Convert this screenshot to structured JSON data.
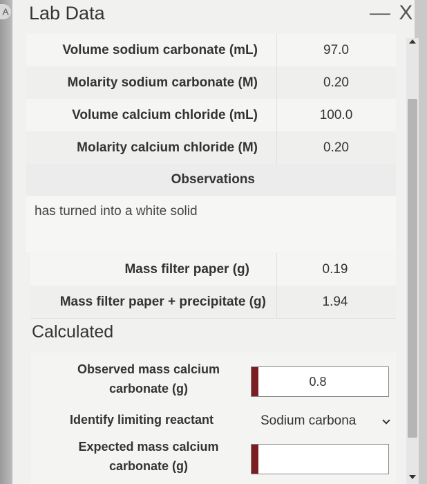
{
  "window": {
    "title": "Lab Data",
    "close_label": "— X",
    "corner_glyph": "A"
  },
  "lab_rows": [
    {
      "label": "Volume sodium carbonate (mL)",
      "value": "97.0"
    },
    {
      "label": "Molarity sodium carbonate (M)",
      "value": "0.20"
    },
    {
      "label": "Volume calcium chloride (mL)",
      "value": "100.0"
    },
    {
      "label": "Molarity calcium chloride (M)",
      "value": "0.20"
    }
  ],
  "observations": {
    "header": "Observations",
    "text": "has turned into a white solid"
  },
  "mass_rows": [
    {
      "label": "Mass filter paper (g)",
      "value": "0.19"
    },
    {
      "label": "Mass filter paper + precipitate (g)",
      "value": "1.94"
    }
  ],
  "calculated": {
    "title": "Calculated",
    "observed_mass": {
      "label_line1": "Observed mass calcium",
      "label_line2": "carbonate (g)",
      "value": "0.8"
    },
    "limiting_reactant": {
      "label": "Identify limiting reactant",
      "selected": "Sodium carbona"
    },
    "expected_mass": {
      "label_line1": "Expected mass calcium",
      "label_line2": "carbonate (g)",
      "value": ""
    }
  },
  "colors": {
    "input_marker": "#7a1e24"
  }
}
